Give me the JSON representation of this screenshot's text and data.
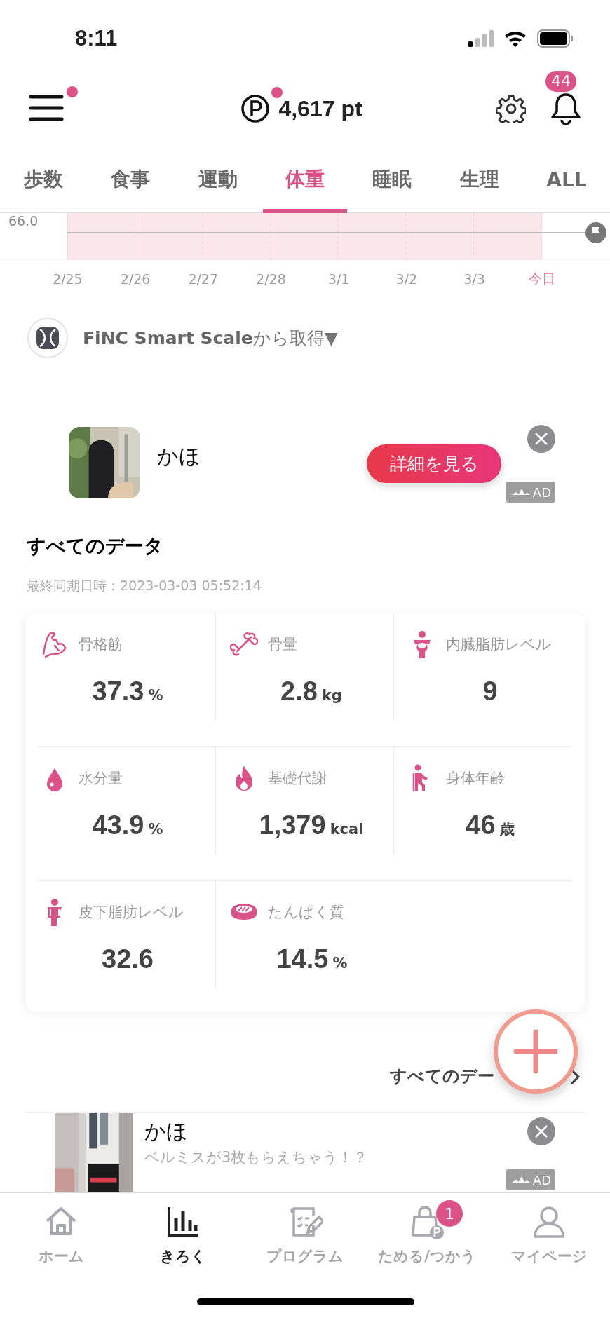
{
  "status_bar": {
    "time": "8:11"
  },
  "header": {
    "menu_unread": true,
    "points": "4,617 pt",
    "points_unread": true,
    "notification_count": "44"
  },
  "tabs": [
    {
      "label": "歩数",
      "selected": false
    },
    {
      "label": "食事",
      "selected": false
    },
    {
      "label": "運動",
      "selected": false
    },
    {
      "label": "体重",
      "selected": true
    },
    {
      "label": "睡眠",
      "selected": false
    },
    {
      "label": "生理",
      "selected": false
    },
    {
      "label": "ALL",
      "selected": false
    }
  ],
  "chart": {
    "y_label": "66.0",
    "dates": [
      {
        "label": "2/25",
        "today": false
      },
      {
        "label": "2/26",
        "today": false
      },
      {
        "label": "2/27",
        "today": false
      },
      {
        "label": "2/28",
        "today": false
      },
      {
        "label": "3/1",
        "today": false
      },
      {
        "label": "3/2",
        "today": false
      },
      {
        "label": "3/3",
        "today": false
      },
      {
        "label": "今日",
        "today": true
      }
    ]
  },
  "source": {
    "text": "**FiNC Smart Scale**から取得▼"
  },
  "ad_top": {
    "title": "かほ",
    "button": "詳細を見る",
    "badge": "AD"
  },
  "all_data": {
    "title": "すべてのデータ",
    "synced": "最終同期日時：2023-03-03 05:52:14",
    "metrics": [
      {
        "label": "骨格筋",
        "value": "37.3",
        "unit": "%"
      },
      {
        "label": "骨量",
        "value": "2.8",
        "unit": "kg"
      },
      {
        "label": "内臓脂肪レベル",
        "value": "9"
      },
      {
        "label": "水分量",
        "value": "43.9",
        "unit": "%"
      },
      {
        "label": "基礎代謝",
        "value": "1,379",
        "unit": "kcal"
      },
      {
        "label": "身体年齢",
        "value": "46",
        "unit": "歳"
      },
      {
        "label": "皮下脂肪レベル",
        "value": "32.6"
      },
      {
        "label": "たんぱく質",
        "value": "14.5",
        "unit": "%"
      }
    ],
    "link": "すべてのデー"
  },
  "ad_bottom": {
    "title": "かほ",
    "subtitle": "ベルミスが3枚もらえちゃう！？",
    "badge": "AD"
  },
  "nav": [
    {
      "label": "ホーム",
      "selected": false
    },
    {
      "label": "きろく",
      "selected": true
    },
    {
      "label": "プログラム",
      "selected": false
    },
    {
      "label": "ためる/つかう",
      "selected": false,
      "badge": "1"
    },
    {
      "label": "マイページ",
      "selected": false
    }
  ]
}
